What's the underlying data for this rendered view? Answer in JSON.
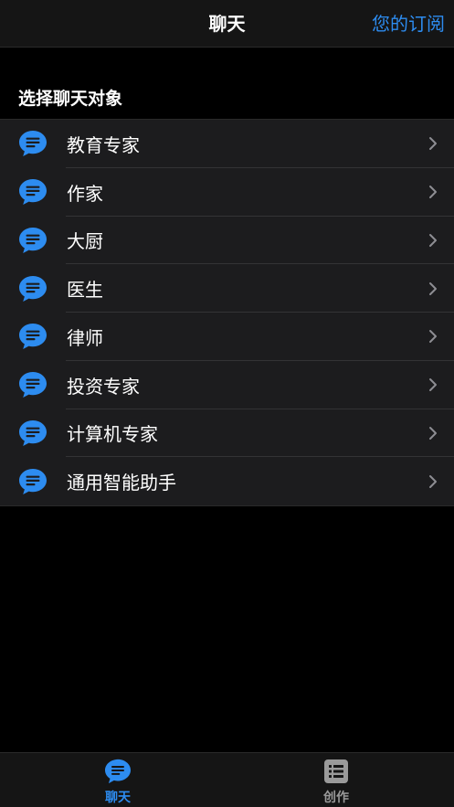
{
  "navbar": {
    "title": "聊天",
    "right_link": "您的订阅"
  },
  "section": {
    "header": "选择聊天对象"
  },
  "list": {
    "items": [
      {
        "label": "教育专家",
        "icon": "chat-bubble-icon"
      },
      {
        "label": "作家",
        "icon": "chat-bubble-icon"
      },
      {
        "label": "大厨",
        "icon": "chat-bubble-icon"
      },
      {
        "label": "医生",
        "icon": "chat-bubble-icon"
      },
      {
        "label": "律师",
        "icon": "chat-bubble-icon"
      },
      {
        "label": "投资专家",
        "icon": "chat-bubble-icon"
      },
      {
        "label": "计算机专家",
        "icon": "chat-bubble-icon"
      },
      {
        "label": "通用智能助手",
        "icon": "chat-bubble-icon"
      }
    ]
  },
  "tabbar": {
    "tabs": [
      {
        "label": "聊天",
        "icon": "chat-bubble-icon",
        "active": true
      },
      {
        "label": "创作",
        "icon": "list-icon",
        "active": false
      }
    ]
  },
  "colors": {
    "accent": "#2d8cf0",
    "background": "#000000",
    "row_background": "#1c1c1e",
    "bar_background": "#151515",
    "inactive": "#9a9a9a"
  }
}
